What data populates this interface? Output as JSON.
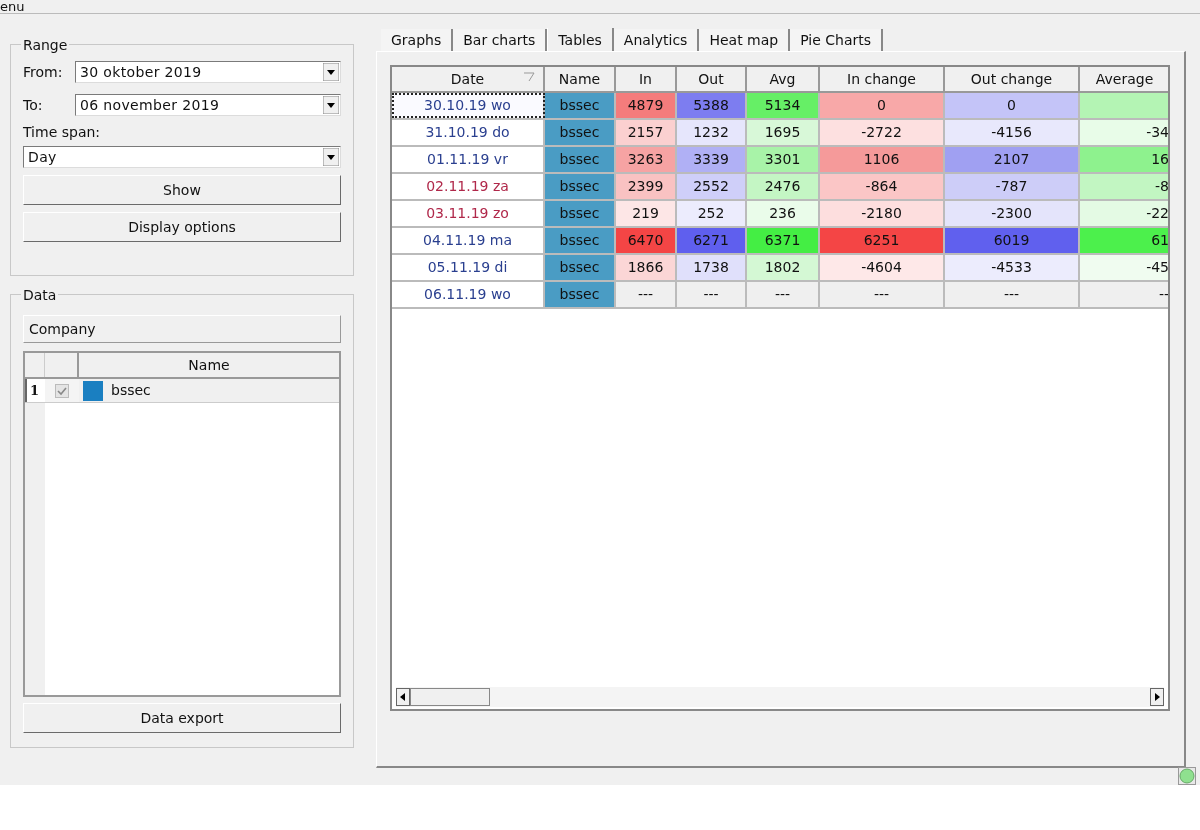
{
  "menu_bar": {
    "label": "enu"
  },
  "range": {
    "title": "Range",
    "from": {
      "label": "From:",
      "value": "30 oktober 2019"
    },
    "to": {
      "label": "To:",
      "value": "06 november 2019"
    },
    "time_span": {
      "label": "Time span:",
      "value": "Day"
    },
    "buttons": [
      "Show",
      "Display options"
    ]
  },
  "data": {
    "title": "Data",
    "company_button": "Company",
    "grid": {
      "columns": [
        "Name"
      ],
      "rows": [
        {
          "number": "1",
          "checked": true,
          "color": "#1a7fc1",
          "name": "bssec"
        }
      ]
    },
    "export_button": "Data export"
  },
  "tabs": [
    {
      "label": "Graphs",
      "selected": false
    },
    {
      "label": "Bar charts",
      "selected": false
    },
    {
      "label": "Tables",
      "selected": true
    },
    {
      "label": "Analytics",
      "selected": false
    },
    {
      "label": "Heat map",
      "selected": false
    },
    {
      "label": "Pie Charts",
      "selected": false
    }
  ],
  "table": {
    "columns": [
      "Date",
      "Name",
      "In",
      "Out",
      "Avg",
      "In change",
      "Out change",
      "Average"
    ],
    "rows": [
      {
        "weekend": false,
        "selected": true,
        "cells": [
          {
            "kind": "date",
            "text": "30.10.19 wo"
          },
          {
            "text": "bssec",
            "color": "#4a9cc4"
          },
          {
            "text": "4879",
            "color": "#f47c7c"
          },
          {
            "text": "5388",
            "color": "#7d7df0"
          },
          {
            "text": "5134",
            "color": "#66ef66"
          },
          {
            "text": "0",
            "color": "#f8a8a8"
          },
          {
            "text": "0",
            "color": "#c4c4f8"
          },
          {
            "color": "#b4f4b4"
          }
        ]
      },
      {
        "weekend": false,
        "selected": false,
        "cells": [
          {
            "kind": "date",
            "text": "31.10.19 do"
          },
          {
            "text": "bssec",
            "color": "#4a9cc4"
          },
          {
            "text": "2157",
            "color": "#fbd0d0"
          },
          {
            "text": "1232",
            "color": "#e6e6fc"
          },
          {
            "text": "1695",
            "color": "#d8f8d8"
          },
          {
            "text": "-2722",
            "color": "#fde0e0"
          },
          {
            "text": "-4156",
            "color": "#e8e8fc"
          },
          {
            "text": "-34",
            "color": "#e8fce8"
          }
        ]
      },
      {
        "weekend": false,
        "selected": false,
        "cells": [
          {
            "kind": "date",
            "text": "01.11.19 vr"
          },
          {
            "text": "bssec",
            "color": "#4a9cc4"
          },
          {
            "text": "3263",
            "color": "#f6a3a3"
          },
          {
            "text": "3339",
            "color": "#b0b0f5"
          },
          {
            "text": "3301",
            "color": "#a8f3a8"
          },
          {
            "text": "1106",
            "color": "#f59a9a"
          },
          {
            "text": "2107",
            "color": "#a0a0f2"
          },
          {
            "text": "16",
            "color": "#8ef28e"
          }
        ]
      },
      {
        "weekend": true,
        "selected": false,
        "cells": [
          {
            "kind": "date",
            "text": "02.11.19 za"
          },
          {
            "text": "bssec",
            "color": "#4a9cc4"
          },
          {
            "text": "2399",
            "color": "#f9c2c2"
          },
          {
            "text": "2552",
            "color": "#cfcff9"
          },
          {
            "text": "2476",
            "color": "#c4f6c4"
          },
          {
            "text": "-864",
            "color": "#fbc6c6"
          },
          {
            "text": "-787",
            "color": "#cdcdf8"
          },
          {
            "text": "-8",
            "color": "#c2f6c2"
          }
        ]
      },
      {
        "weekend": true,
        "selected": false,
        "cells": [
          {
            "kind": "date",
            "text": "03.11.19 zo"
          },
          {
            "text": "bssec",
            "color": "#4a9cc4"
          },
          {
            "text": "219",
            "color": "#fde6e6"
          },
          {
            "text": "252",
            "color": "#ececfd"
          },
          {
            "text": "236",
            "color": "#eafcea"
          },
          {
            "text": "-2180",
            "color": "#fddede"
          },
          {
            "text": "-2300",
            "color": "#e4e4fb"
          },
          {
            "text": "-22",
            "color": "#e4fae4"
          }
        ]
      },
      {
        "weekend": false,
        "selected": false,
        "cells": [
          {
            "kind": "date",
            "text": "04.11.19 ma"
          },
          {
            "text": "bssec",
            "color": "#4a9cc4"
          },
          {
            "text": "6470",
            "color": "#f44545"
          },
          {
            "text": "6271",
            "color": "#5f5fee"
          },
          {
            "text": "6371",
            "color": "#44ee44"
          },
          {
            "text": "6251",
            "color": "#f44545"
          },
          {
            "text": "6019",
            "color": "#6060ee"
          },
          {
            "text": "61",
            "color": "#4cf04c"
          }
        ]
      },
      {
        "weekend": false,
        "selected": false,
        "cells": [
          {
            "kind": "date",
            "text": "05.11.19 di"
          },
          {
            "text": "bssec",
            "color": "#4a9cc4"
          },
          {
            "text": "1866",
            "color": "#fbd6d6"
          },
          {
            "text": "1738",
            "color": "#e0e0fb"
          },
          {
            "text": "1802",
            "color": "#d4f8d4"
          },
          {
            "text": "-4604",
            "color": "#fee8e8"
          },
          {
            "text": "-4533",
            "color": "#ececfd"
          },
          {
            "text": "-45",
            "color": "#f0fcf0"
          }
        ]
      },
      {
        "weekend": false,
        "selected": false,
        "cells": [
          {
            "kind": "date",
            "text": "06.11.19 wo"
          },
          {
            "text": "bssec",
            "color": "#4a9cc4"
          },
          {
            "text": "---",
            "color": "#efefef"
          },
          {
            "text": "---",
            "color": "#efefef"
          },
          {
            "text": "---",
            "color": "#efefef"
          },
          {
            "text": "---",
            "color": "#efefef"
          },
          {
            "text": "---",
            "color": "#efefef"
          },
          {
            "text": "--",
            "color": "#efefef"
          }
        ]
      }
    ]
  }
}
